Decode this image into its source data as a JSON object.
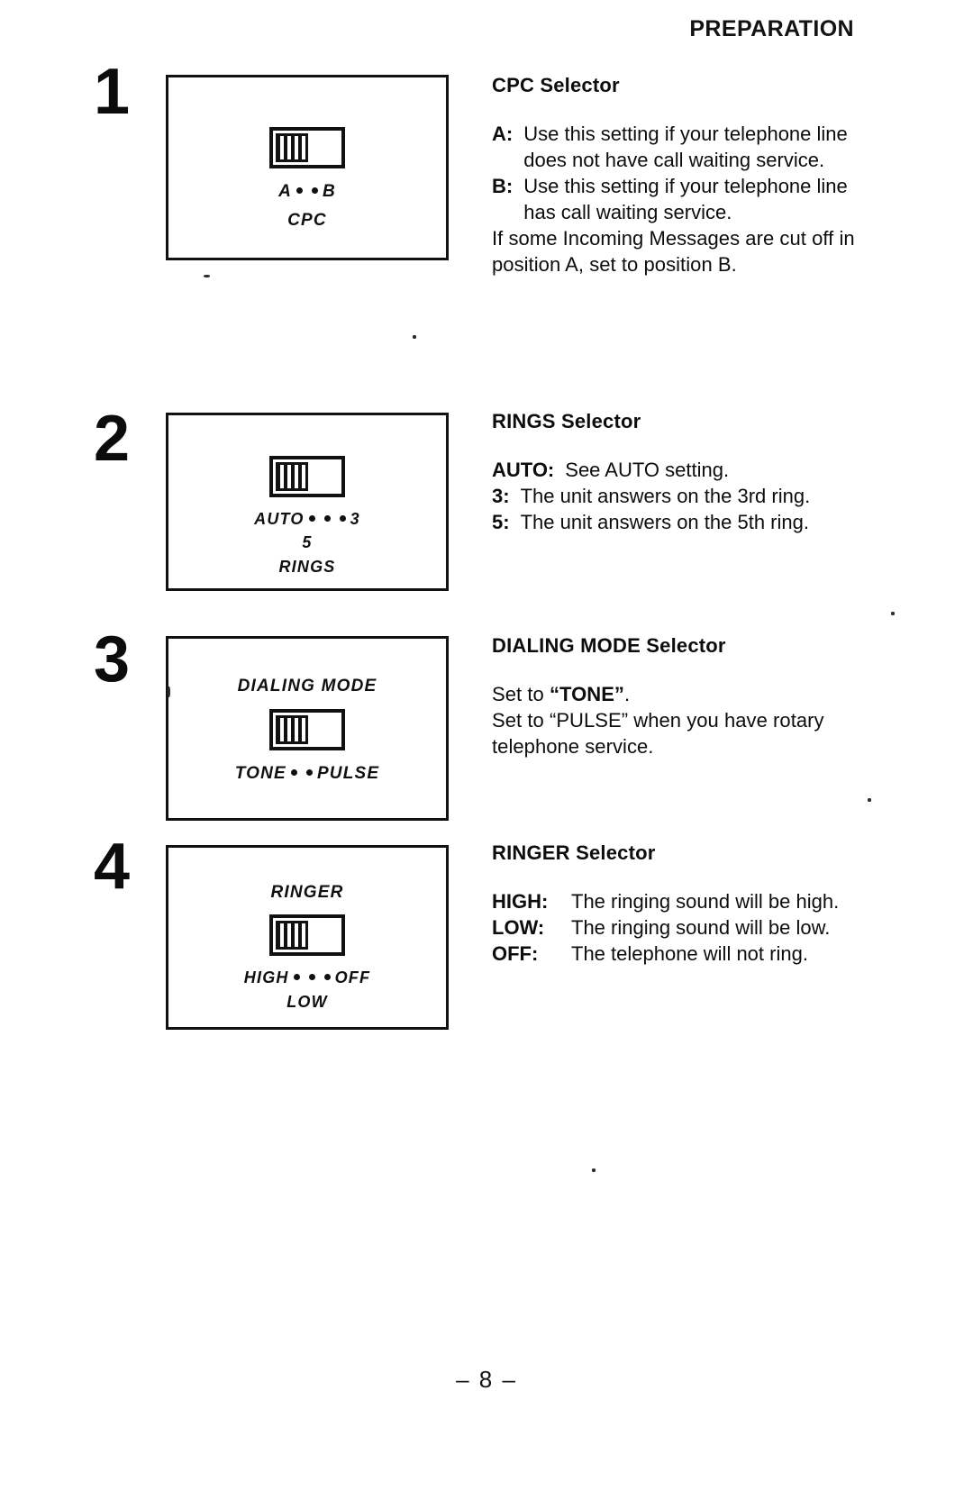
{
  "page": {
    "header_title": "PREPARATION",
    "footer": "– 8 –"
  },
  "steps": [
    {
      "number": "1",
      "figure": {
        "label_above": "",
        "switch_position": "left",
        "label_below_1_left": "A",
        "label_below_1_right": "B",
        "label_below_1_dots": 2,
        "label_below_2": "CPC",
        "label_below_3": ""
      },
      "section": {
        "title": "CPC Selector",
        "definitions": [
          {
            "term": "A:",
            "desc": "Use this setting if your telephone line does not have call waiting service."
          },
          {
            "term": "B:",
            "desc": "Use this setting if your telephone line has call waiting service."
          }
        ],
        "paragraph": "If some Incoming Messages are cut off in position A, set to position B."
      }
    },
    {
      "number": "2",
      "figure": {
        "label_above": "",
        "switch_position": "left",
        "label_below_1_left": "AUTO",
        "label_below_1_right": "3",
        "label_below_1_dots": 3,
        "label_below_2": "5",
        "label_below_3": "RINGS"
      },
      "section": {
        "title": "RINGS Selector",
        "definitions": [
          {
            "term": "AUTO:",
            "desc": "See AUTO setting."
          },
          {
            "term": "3:",
            "desc": "The unit answers on the 3rd ring."
          },
          {
            "term": "5:",
            "desc": "The unit answers on the 5th ring."
          }
        ],
        "paragraph": ""
      }
    },
    {
      "number": "3",
      "figure": {
        "label_above": "DIALING MODE",
        "switch_position": "left",
        "label_below_1_left": "TONE",
        "label_below_1_right": "PULSE",
        "label_below_1_dots": 2,
        "label_below_2": "",
        "label_below_3": ""
      },
      "section": {
        "title": "DIALING MODE Selector",
        "definitions": [],
        "paragraph_rich": [
          {
            "pre": "Set to ",
            "bold": "“TONE”",
            "post": "."
          },
          {
            "pre": "Set to “PULSE” when you have rotary telephone service.",
            "bold": "",
            "post": ""
          }
        ]
      }
    },
    {
      "number": "4",
      "figure": {
        "label_above": "RINGER",
        "switch_position": "left",
        "label_below_1_left": "HIGH",
        "label_below_1_right": "OFF",
        "label_below_1_dots": 3,
        "label_below_2": "LOW",
        "label_below_3": ""
      },
      "section": {
        "title": "RINGER Selector",
        "definitions": [
          {
            "term": "HIGH:",
            "desc": "The ringing sound will be high."
          },
          {
            "term": "LOW:",
            "desc": "The ringing sound will be low."
          },
          {
            "term": "OFF:",
            "desc": "The telephone will not ring."
          }
        ],
        "paragraph": ""
      }
    }
  ]
}
